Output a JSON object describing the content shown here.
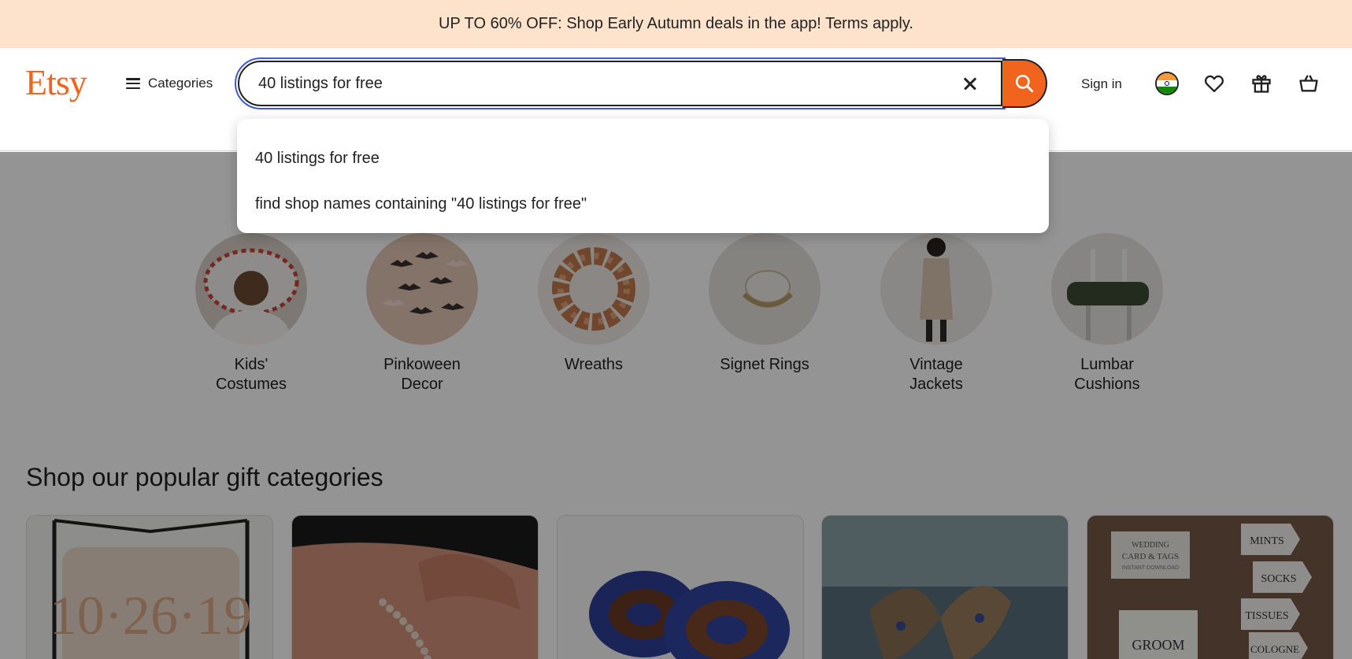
{
  "promo": {
    "text": "UP TO 60% OFF: Shop Early Autumn deals in the app! Terms apply."
  },
  "header": {
    "logo": "Etsy",
    "categories_label": "Categories",
    "search_value": "40 listings for free",
    "signin_label": "Sign in"
  },
  "suggestions": [
    {
      "text": "40 listings for free"
    },
    {
      "text": "find shop names containing \"40 listings for free\""
    }
  ],
  "circles": [
    {
      "line1": "Kids'",
      "line2": "Costumes"
    },
    {
      "line1": "Pinkoween",
      "line2": "Decor"
    },
    {
      "line1": "Wreaths",
      "line2": ""
    },
    {
      "line1": "Signet Rings",
      "line2": ""
    },
    {
      "line1": "Vintage",
      "line2": "Jackets"
    },
    {
      "line1": "Lumbar",
      "line2": "Cushions"
    }
  ],
  "section": {
    "title": "Shop our popular gift categories"
  },
  "gift_cards": [
    {
      "image": "book-fold-art"
    },
    {
      "image": "beaded-bracelet"
    },
    {
      "image": "beaded-brooches"
    },
    {
      "image": "butterfly-sculpture"
    },
    {
      "image": "wedding-tags"
    }
  ],
  "gift_card_text": [
    "10·26·19",
    "WEDDING",
    "CARD & TAGS",
    "INSTANT DOWNLOAD",
    "MINTS",
    "SOCKS",
    "TISSUES",
    "GROOM",
    "COLOGNE"
  ],
  "colors": {
    "brand": "#f1641e",
    "promo_bg": "#fde3cc",
    "focus_ring": "#3b5bdb"
  },
  "icons": [
    "menu-icon",
    "close-icon",
    "search-icon",
    "india-flag-icon",
    "heart-icon",
    "gift-icon",
    "bag-icon"
  ]
}
